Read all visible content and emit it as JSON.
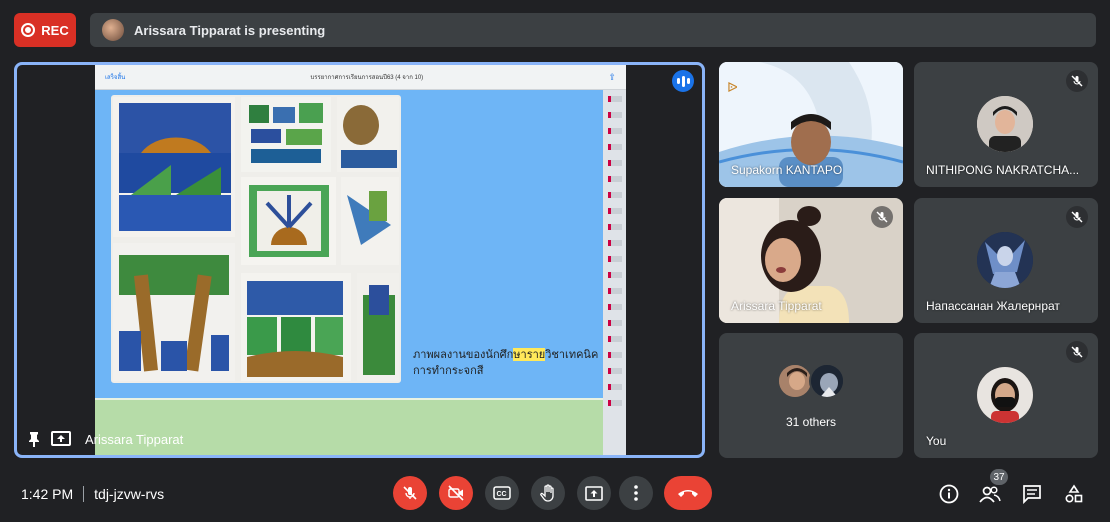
{
  "top": {
    "rec_label": "REC",
    "presenting_text": "Arissara Tipparat is presenting"
  },
  "stage": {
    "presenter_name": "Arissara Tipparat",
    "slide": {
      "header_left": "เสร็จสิ้น",
      "header_title": "บรรยากาศการเรียนการสอนปี63 (4 จาก 10)",
      "caption_part1": "ภาพผลงานของนักศึก",
      "caption_highlight": "ษาราย",
      "caption_part2": "วิชาเทคนิคการทำกระจกสี"
    }
  },
  "participants": [
    {
      "name": "Supakorn KANTAPO",
      "muted": false
    },
    {
      "name": "NITHIPONG NAKRATCHA...",
      "muted": true
    },
    {
      "name": "Arissara Tipparat",
      "muted": true
    },
    {
      "name": "Напассанан Жалернрат",
      "muted": true
    },
    {
      "name": "31 others",
      "muted": false
    },
    {
      "name": "You",
      "muted": true
    }
  ],
  "bottom": {
    "time": "1:42 PM",
    "meeting_code": "tdj-jzvw-rvs",
    "people_count": "37"
  },
  "colors": {
    "background": "#202124",
    "tile": "#3c4043",
    "danger": "#ea4335",
    "accent": "#8ab4f8"
  }
}
